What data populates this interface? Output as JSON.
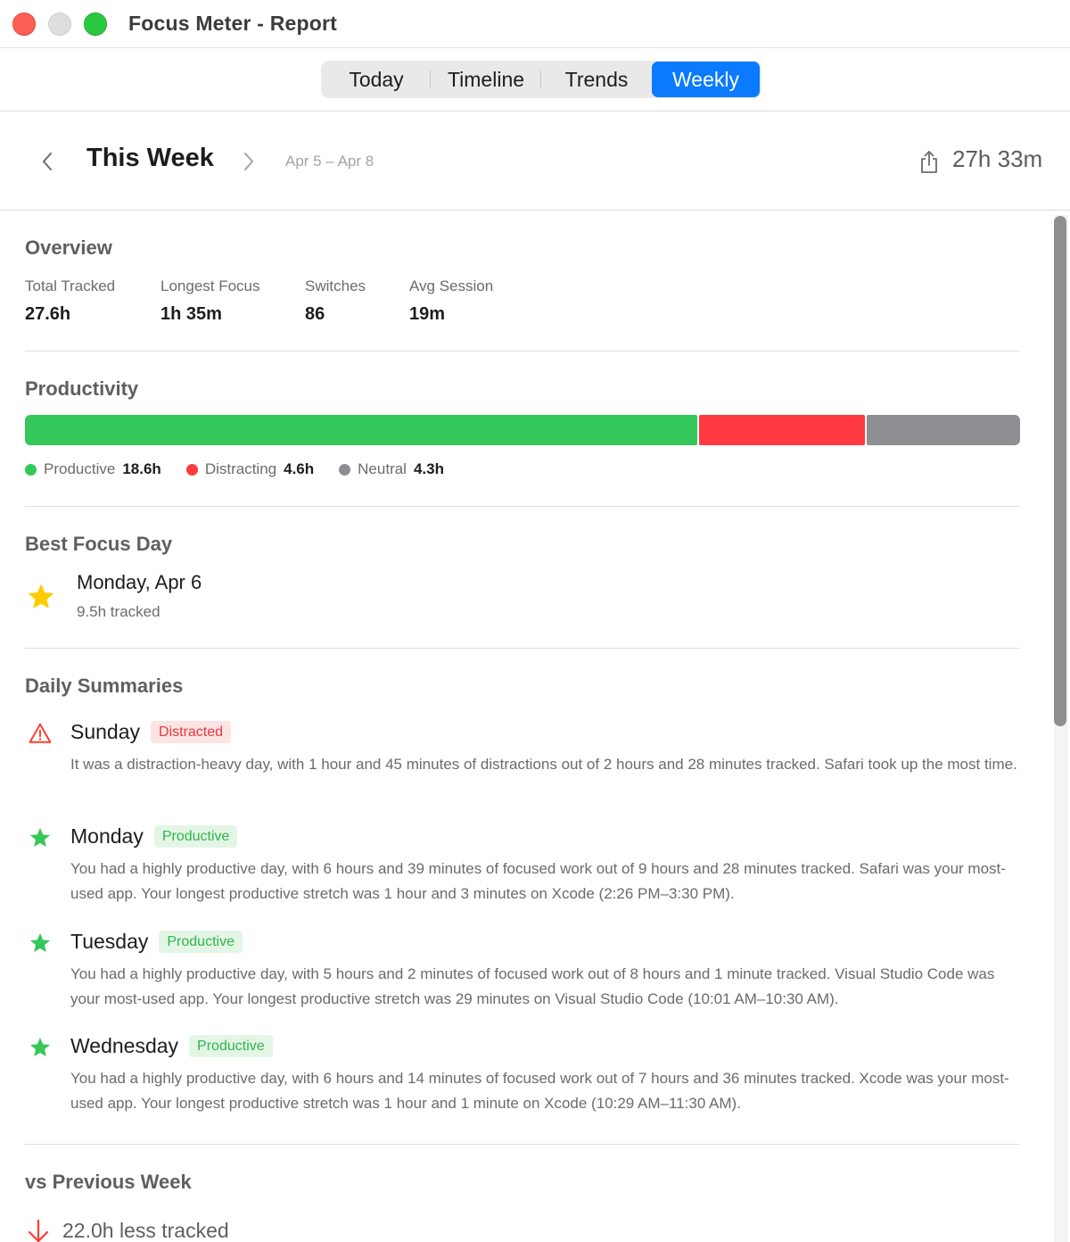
{
  "window": {
    "title": "Focus Meter - Report"
  },
  "tabs": [
    {
      "label": "Today",
      "active": false
    },
    {
      "label": "Timeline",
      "active": false
    },
    {
      "label": "Trends",
      "active": false
    },
    {
      "label": "Weekly",
      "active": true
    }
  ],
  "week": {
    "title": "This Week",
    "range": "Apr 5 – Apr 8",
    "total": "27h 33m",
    "prev_icon": "chevron-left-icon",
    "next_icon": "chevron-right-icon",
    "share_icon": "share-icon"
  },
  "overview": {
    "title": "Overview",
    "stats": [
      {
        "label": "Total Tracked",
        "value": "27.6h"
      },
      {
        "label": "Longest Focus",
        "value": "1h 35m"
      },
      {
        "label": "Switches",
        "value": "86"
      },
      {
        "label": "Avg Session",
        "value": "19m"
      }
    ]
  },
  "productivity": {
    "title": "Productivity",
    "segments": [
      {
        "name": "Productive",
        "value": "18.6h",
        "hours": 18.6,
        "color": "#34c759"
      },
      {
        "name": "Distracting",
        "value": "4.6h",
        "hours": 4.6,
        "color": "#ff3a40"
      },
      {
        "name": "Neutral",
        "value": "4.3h",
        "hours": 4.3,
        "color": "#8e8e93"
      }
    ]
  },
  "best_day": {
    "title": "Best Focus Day",
    "day": "Monday, Apr 6",
    "tracked": "9.5h tracked",
    "icon": "star-icon",
    "color": "#ffcc00"
  },
  "daily": {
    "title": "Daily Summaries",
    "days": [
      {
        "name": "Sunday",
        "badge": "Distracted",
        "icon": "warning-triangle-icon",
        "text": "It was a distraction-heavy day, with 1 hour and 45 minutes of distractions out of 2 hours and 28 minutes tracked. Safari took up the most time."
      },
      {
        "name": "Monday",
        "badge": "Productive",
        "icon": "star-icon",
        "text": "You had a highly productive day, with 6 hours and 39 minutes of focused work out of 9 hours and 28 minutes tracked. Safari was your most-used app. Your longest productive stretch was 1 hour and 3 minutes on Xcode (2:26 PM–3:30 PM)."
      },
      {
        "name": "Tuesday",
        "badge": "Productive",
        "icon": "star-icon",
        "text": "You had a highly productive day, with 5 hours and 2 minutes of focused work out of 8 hours and 1 minute tracked. Visual Studio Code was your most-used app. Your longest productive stretch was 29 minutes on Visual Studio Code (10:01 AM–10:30 AM)."
      },
      {
        "name": "Wednesday",
        "badge": "Productive",
        "icon": "star-icon",
        "text": "You had a highly productive day, with 6 hours and 14 minutes of focused work out of 7 hours and 36 minutes tracked. Xcode was your most-used app. Your longest productive stretch was 1 hour and 1 minute on Xcode (10:29 AM–11:30 AM)."
      }
    ]
  },
  "comparison": {
    "title": "vs Previous Week",
    "text": "22.0h less tracked",
    "icon": "arrow-down-icon",
    "color": "#ff3b30"
  }
}
